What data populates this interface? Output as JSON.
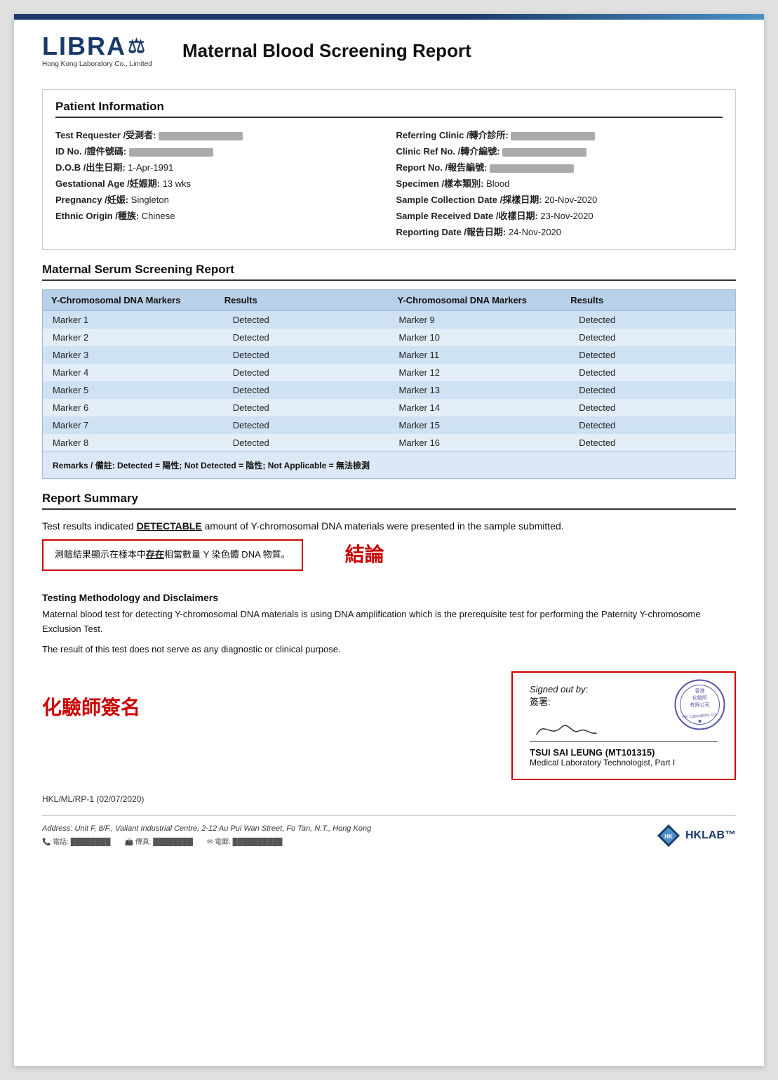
{
  "topBar": {},
  "header": {
    "logoText": "LIBRA",
    "logoSub": "Hong Kong Laboratory Co., Limited",
    "reportTitle": "Maternal Blood Screening Report"
  },
  "patientInfo": {
    "sectionTitle": "Patient Information",
    "leftFields": [
      {
        "label": "Test Requester /受測者:",
        "value": ""
      },
      {
        "label": "ID No. /證件號碼:",
        "value": ""
      },
      {
        "label": "D.O.B /出生日期:",
        "value": "1-Apr-1991"
      },
      {
        "label": "Gestational Age /妊娠期:",
        "value": "13 wks"
      },
      {
        "label": "Pregnancy /妊娠:",
        "value": "Singleton"
      },
      {
        "label": "Ethnic Origin /種族:",
        "value": "Chinese"
      }
    ],
    "rightFields": [
      {
        "label": "Referring Clinic /轉介診所:",
        "value": ""
      },
      {
        "label": "Clinic Ref No. /轉介編號:",
        "value": ""
      },
      {
        "label": "Report No. /報告編號:",
        "value": ""
      },
      {
        "label": "Specimen /樣本類別:",
        "value": "Blood"
      },
      {
        "label": "Sample Collection Date /採樣日期:",
        "value": "20-Nov-2020"
      },
      {
        "label": "Sample Received Date /收樣日期:",
        "value": "23-Nov-2020"
      },
      {
        "label": "Reporting Date /報告日期:",
        "value": "24-Nov-2020"
      }
    ]
  },
  "maternalSerum": {
    "sectionTitle": "Maternal Serum Screening Report",
    "tableHeaders": {
      "col1": "Y-Chromosomal DNA Markers",
      "col2": "Results",
      "col3": "Y-Chromosomal DNA Markers",
      "col4": "Results"
    },
    "rows": [
      {
        "marker1": "Marker 1",
        "result1": "Detected",
        "marker2": "Marker 9",
        "result2": "Detected"
      },
      {
        "marker1": "Marker 2",
        "result1": "Detected",
        "marker2": "Marker 10",
        "result2": "Detected"
      },
      {
        "marker1": "Marker 3",
        "result1": "Detected",
        "marker2": "Marker 11",
        "result2": "Detected"
      },
      {
        "marker1": "Marker 4",
        "result1": "Detected",
        "marker2": "Marker 12",
        "result2": "Detected"
      },
      {
        "marker1": "Marker 5",
        "result1": "Detected",
        "marker2": "Marker 13",
        "result2": "Detected"
      },
      {
        "marker1": "Marker 6",
        "result1": "Detected",
        "marker2": "Marker 14",
        "result2": "Detected"
      },
      {
        "marker1": "Marker 7",
        "result1": "Detected",
        "marker2": "Marker 15",
        "result2": "Detected"
      },
      {
        "marker1": "Marker 8",
        "result1": "Detected",
        "marker2": "Marker 16",
        "result2": "Detected"
      }
    ],
    "remarks": "Remarks / 備註: Detected = 陽性; Not Detected = 陰性; Not Applicable = 無法檢測"
  },
  "reportSummary": {
    "sectionTitle": "Report Summary",
    "summaryLine1": "Test results indicated ",
    "summaryDetectable": "DETECTABLE",
    "summaryLine2": " amount of Y-chromosomal DNA materials were presented in the sample",
    "summaryLine3": "submitted.",
    "chineseSummary": "測驗結果顯示在樣本中",
    "chineseExist": "存在",
    "chineseSummary2": "相當數量 Y 染色體 DNA 物質。",
    "conclusionLabel": "結論"
  },
  "methodology": {
    "title": "Testing Methodology and Disclaimers",
    "para1": "Maternal blood test for detecting Y-chromosomal DNA materials is using DNA amplification which is the prerequisite test for performing the Paternity Y-chromosome Exclusion Test.",
    "para2": "The result of this test does not serve as any diagnostic or clinical purpose."
  },
  "signature": {
    "chemistLabel": "化驗師簽名",
    "signedOutBy": "Signed out by:",
    "signChinese": "簽署:",
    "signerName": "TSUI SAI LEUNG (MT101315)",
    "signerTitle": "Medical Laboratory Technologist, Part I"
  },
  "footer": {
    "ref": "HKL/ML/RP-1 (02/07/2020)",
    "address": "Address: Unit F, 8/F., Valiant Industrial Centre, 2-12 Au Pui Wan Street, Fo Tan, N.T., Hong Kong",
    "hklabLabel": "HKLAB"
  }
}
